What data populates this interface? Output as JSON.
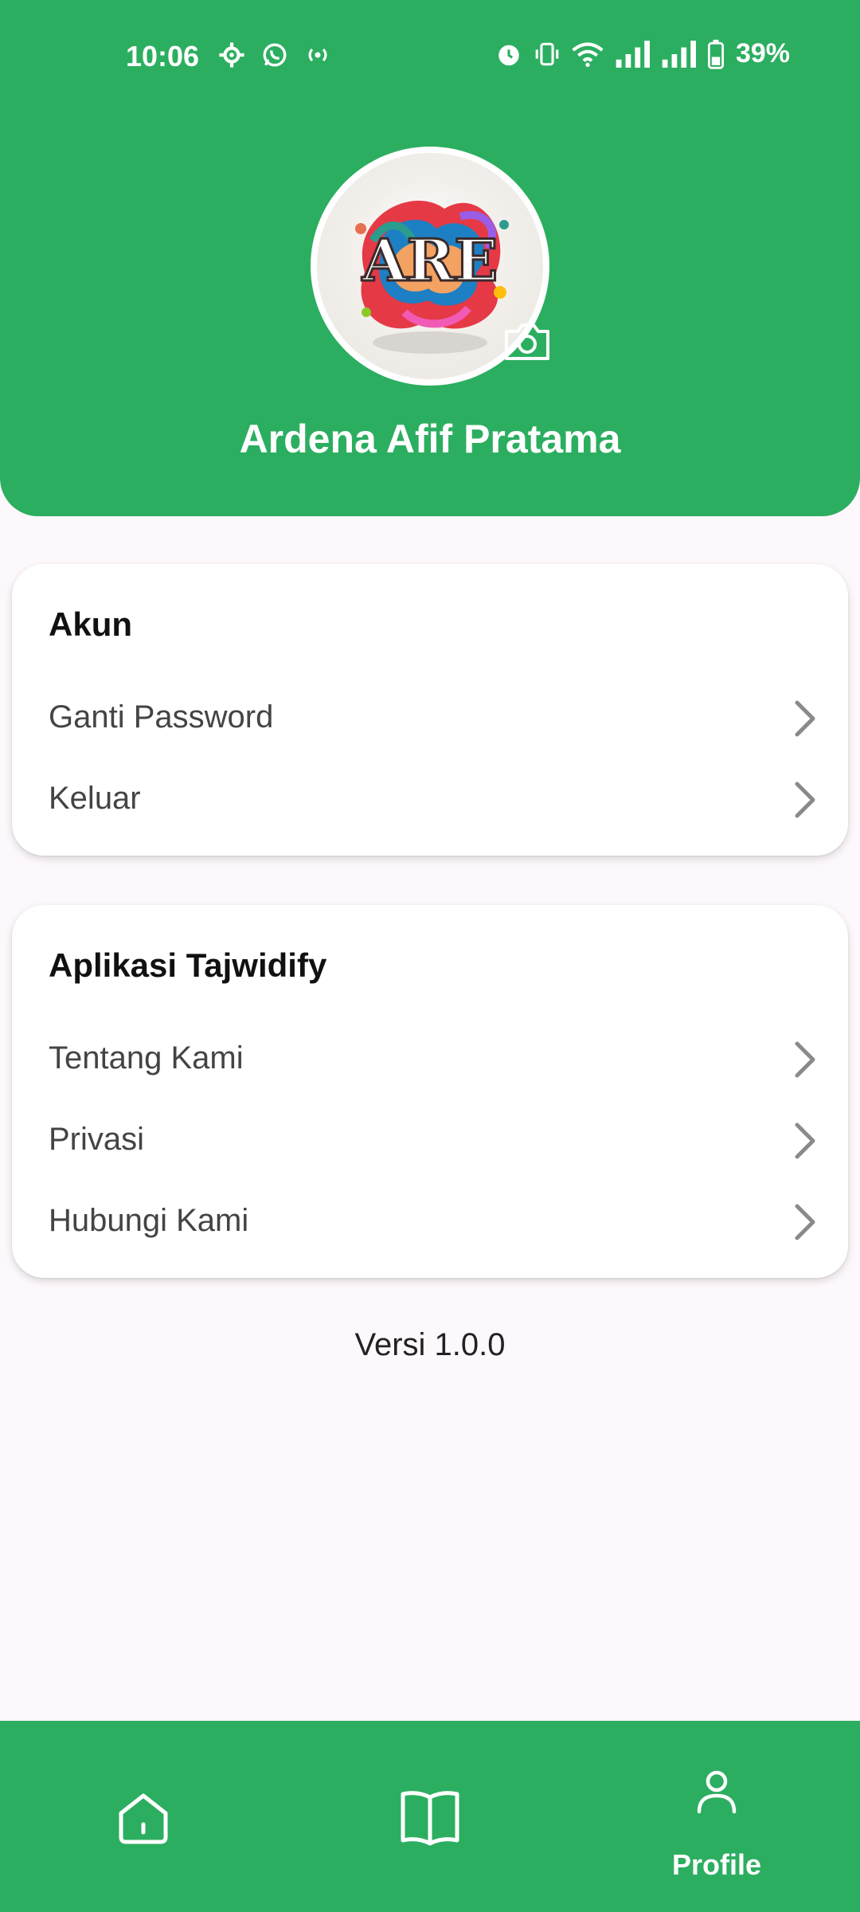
{
  "status_bar": {
    "time": "10:06",
    "battery": "39%",
    "icons": [
      "settings-icon",
      "whatsapp-icon",
      "hotspot-icon",
      "alarm-icon",
      "vibrate-icon",
      "wifi-icon",
      "signal-icon",
      "signal-icon",
      "battery-icon"
    ]
  },
  "profile": {
    "name": "Ardena Afif Pratama",
    "avatar_text": "ARE",
    "camera_icon": "camera-icon"
  },
  "account_section": {
    "title": "Akun",
    "items": [
      {
        "label": "Ganti Password"
      },
      {
        "label": "Keluar"
      }
    ]
  },
  "app_section": {
    "title": "Aplikasi Tajwidify",
    "items": [
      {
        "label": "Tentang Kami"
      },
      {
        "label": "Privasi"
      },
      {
        "label": "Hubungi Kami"
      }
    ]
  },
  "version": "Versi 1.0.0",
  "bottom_nav": {
    "items": [
      {
        "icon": "home-icon",
        "label": ""
      },
      {
        "icon": "book-icon",
        "label": ""
      },
      {
        "icon": "profile-icon",
        "label": "Profile"
      }
    ]
  },
  "colors": {
    "primary_green": "#2cae60",
    "background": "#fdf8fb",
    "card": "#ffffff"
  }
}
